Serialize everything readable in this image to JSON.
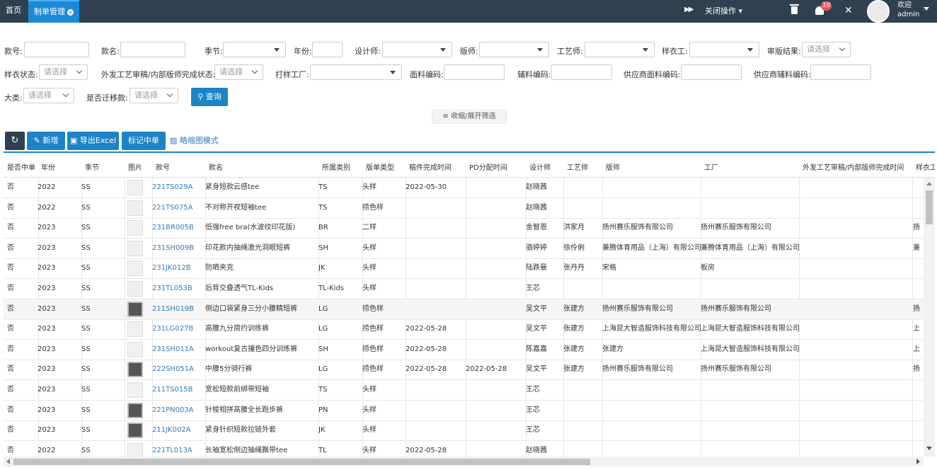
{
  "topbar": {
    "home_tab": "首页",
    "active_tab": "制单管理",
    "close_ops": "关闭操作",
    "notification_count": "10",
    "welcome": "欢迎",
    "user": "admin"
  },
  "filters": {
    "style_no_label": "款号:",
    "style_name_label": "款名:",
    "season_label": "季节:",
    "year_label": "年份:",
    "designer_label": "设计师:",
    "pattern_maker_label": "版师:",
    "technician_label": "工艺师:",
    "sample_worker_label": "样衣工:",
    "review_result_label": "审版结果:",
    "review_result_value": "请选择",
    "sample_status_label": "样衣状态:",
    "sample_status_value": "请选择",
    "outsource_label": "外发工艺审稿/内部版师完成状态:",
    "outsource_value": "请选择",
    "factory_label": "打样工厂:",
    "fabric_code_label": "面料编码:",
    "accessory_code_label": "辅料编码:",
    "supplier_fabric_label": "供应商面料编码:",
    "supplier_accessory_label": "供应商辅料编码:",
    "category_label": "大类:",
    "category_value": "请选择",
    "migrated_label": "是否迁移款:",
    "migrated_value": "请选择",
    "query_button": "查询",
    "collapse_toggle": "收缩/展开筛选"
  },
  "toolbar": {
    "add": "新增",
    "export": "导出Excel",
    "mark": "标记中单",
    "thumbnail_mode": "略缩图模式"
  },
  "table": {
    "headers": [
      "是否中单",
      "年份",
      "季节",
      "图片",
      "款号",
      "款名",
      "所属类别",
      "版单类型",
      "稿件完成时间",
      "PD分配时间",
      "设计师",
      "工艺师",
      "版师",
      "工厂",
      "外发工艺审稿/内部版师完成时间",
      "样衣工"
    ],
    "rows": [
      {
        "hit": "否",
        "year": "2022",
        "season": "SS",
        "no": "221TS029A",
        "name": "紧身短款云感tee",
        "cat": "TS",
        "type": "头样",
        "done": "2022-05-30",
        "pd": "",
        "designer": "赵晓茜",
        "tech": "",
        "pm": "",
        "factory": "",
        "out": "",
        "worker": ""
      },
      {
        "hit": "否",
        "year": "2022",
        "season": "SS",
        "no": "221TS075A",
        "name": "不对称开衩短袖tee",
        "cat": "TS",
        "type": "捞色样",
        "done": "",
        "pd": "",
        "designer": "赵晓茜",
        "tech": "",
        "pm": "",
        "factory": "",
        "out": "",
        "worker": ""
      },
      {
        "hit": "否",
        "year": "2023",
        "season": "SS",
        "no": "231BR005B",
        "name": "低强free bra(水波纹印花版)",
        "cat": "BR",
        "type": "二样",
        "done": "",
        "pd": "",
        "designer": "金智恩",
        "tech": "洪家月",
        "pm": "扬州赛乐服饰有限公司",
        "factory": "扬州赛乐服饰有限公司",
        "out": "",
        "worker": "扬"
      },
      {
        "hit": "否",
        "year": "2023",
        "season": "SS",
        "no": "231SH009B",
        "name": "印花款内抽绳激光洞眼短裤",
        "cat": "SH",
        "type": "头样",
        "done": "",
        "pd": "",
        "designer": "骆婷婷",
        "tech": "徐伶俐",
        "pm": "兼腾体育用品（上海）有限公司",
        "factory": "兼腾体育用品（上海）有限公司",
        "out": "",
        "worker": "兼"
      },
      {
        "hit": "否",
        "year": "2023",
        "season": "SS",
        "no": "231JK012B",
        "name": "防晒夹克",
        "cat": "JK",
        "type": "头样",
        "done": "",
        "pd": "",
        "designer": "陆跌曼",
        "tech": "张丹丹",
        "pm": "宋格",
        "factory": "板房",
        "out": "",
        "worker": ""
      },
      {
        "hit": "否",
        "year": "2023",
        "season": "SS",
        "no": "231TL053B",
        "name": "后背交叠透气TL-Kids",
        "cat": "TL-Kids",
        "type": "头样",
        "done": "",
        "pd": "",
        "designer": "王芯",
        "tech": "",
        "pm": "",
        "factory": "",
        "out": "",
        "worker": ""
      },
      {
        "hit": "否",
        "year": "2023",
        "season": "SS",
        "no": "211SH019B",
        "name": "侧边口袋紧身三分小腰精短裤",
        "cat": "LG",
        "type": "捞色样",
        "done": "",
        "pd": "",
        "designer": "吴文平",
        "tech": "张建方",
        "pm": "扬州赛乐服饰有限公司",
        "factory": "扬州赛乐服饰有限公司",
        "out": "",
        "worker": "扬"
      },
      {
        "hit": "否",
        "year": "2023",
        "season": "SS",
        "no": "231LG027B",
        "name": "高腰九分简约训练裤",
        "cat": "LG",
        "type": "捞色样",
        "done": "2022-05-28",
        "pd": "",
        "designer": "吴文平",
        "tech": "张建方",
        "pm": "上海昆大智造服饰科技有限公司",
        "factory": "上海昆大智造服饰科技有限公司",
        "out": "",
        "worker": "上"
      },
      {
        "hit": "否",
        "year": "2023",
        "season": "SS",
        "no": "231SH011A",
        "name": "workout复古撞色四分训练裤",
        "cat": "SH",
        "type": "捞色样",
        "done": "2022-05-28",
        "pd": "",
        "designer": "陈嘉嘉",
        "tech": "张建方",
        "pm": "张建方",
        "factory": "上海昆大智造服饰科技有限公司",
        "out": "",
        "worker": "上"
      },
      {
        "hit": "否",
        "year": "2023",
        "season": "SS",
        "no": "222SH051A",
        "name": "中腰5分骑行裤",
        "cat": "LG",
        "type": "捞色样",
        "done": "2022-05-28",
        "pd": "2022-05-28",
        "designer": "吴文平",
        "tech": "张建方",
        "pm": "扬州赛乐服饰有限公司",
        "factory": "扬州赛乐服饰有限公司",
        "out": "",
        "worker": "扬"
      },
      {
        "hit": "否",
        "year": "2023",
        "season": "SS",
        "no": "211TS015B",
        "name": "宽松短款前绑带短袖",
        "cat": "TS",
        "type": "头样",
        "done": "",
        "pd": "",
        "designer": "王芯",
        "tech": "",
        "pm": "",
        "factory": "",
        "out": "",
        "worker": ""
      },
      {
        "hit": "否",
        "year": "2023",
        "season": "SS",
        "no": "221PN003A",
        "name": "针梭相拼高腰全长跑步裤",
        "cat": "PN",
        "type": "头样",
        "done": "",
        "pd": "",
        "designer": "王芯",
        "tech": "",
        "pm": "",
        "factory": "",
        "out": "",
        "worker": ""
      },
      {
        "hit": "否",
        "year": "2023",
        "season": "SS",
        "no": "211JK002A",
        "name": "紧身针织短款拉链外套",
        "cat": "JK",
        "type": "头样",
        "done": "",
        "pd": "",
        "designer": "王芯",
        "tech": "",
        "pm": "",
        "factory": "",
        "out": "",
        "worker": ""
      },
      {
        "hit": "否",
        "year": "2022",
        "season": "SS",
        "no": "221TL013A",
        "name": "长袖宽松侧边抽绳飘带tee",
        "cat": "TL",
        "type": "头样",
        "done": "2022-05-28",
        "pd": "",
        "designer": "赵晓茜",
        "tech": "",
        "pm": "",
        "factory": "",
        "out": "",
        "worker": ""
      }
    ]
  }
}
